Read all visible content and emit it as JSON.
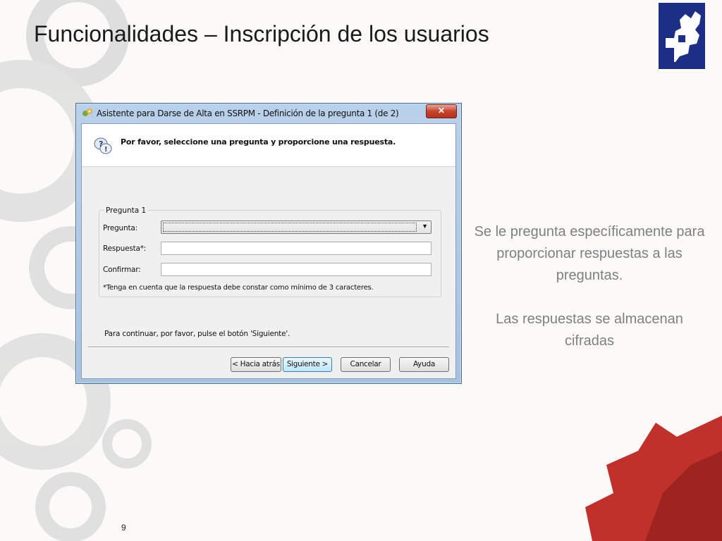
{
  "slide": {
    "title": "Funcionalidades – Inscripción de los usuarios",
    "page_number": "9",
    "caption_paragraphs": [
      "Se le pregunta específicamente para proporcionar respuestas a las preguntas.",
      "Las respuestas se almacenan cifradas"
    ]
  },
  "window": {
    "title": "Asistente para Darse de Alta en SSRPM - Definición de la pregunta 1 (de 2)",
    "close_label": "✕",
    "header_text": "Por favor, seleccione una pregunta y proporcione una respuesta.",
    "group_title": "Pregunta 1",
    "fields": {
      "question_label": "Pregunta:",
      "question_value": "",
      "answer_label": "Respuesta*:",
      "answer_value": "",
      "confirm_label": "Confirmar:",
      "confirm_value": ""
    },
    "note": "*Tenga en cuenta que la respuesta debe constar como mínimo de 3 caracteres.",
    "continue_text": "Para continuar, por favor, pulse el botón 'Siguiente'.",
    "buttons": {
      "back": "< Hacia atrás",
      "next": "Siguiente >",
      "cancel": "Cancelar",
      "help": "Ayuda"
    }
  },
  "icons": {
    "title_icon": "wizard-icon",
    "header_icon": "help-speech-icon",
    "logo": "gear-logo-icon"
  },
  "colors": {
    "logo_blue": "#1d2e86",
    "gear_red": "#c0312c",
    "gear_gray": "#d8d8d8",
    "caption_gray": "#808080"
  }
}
